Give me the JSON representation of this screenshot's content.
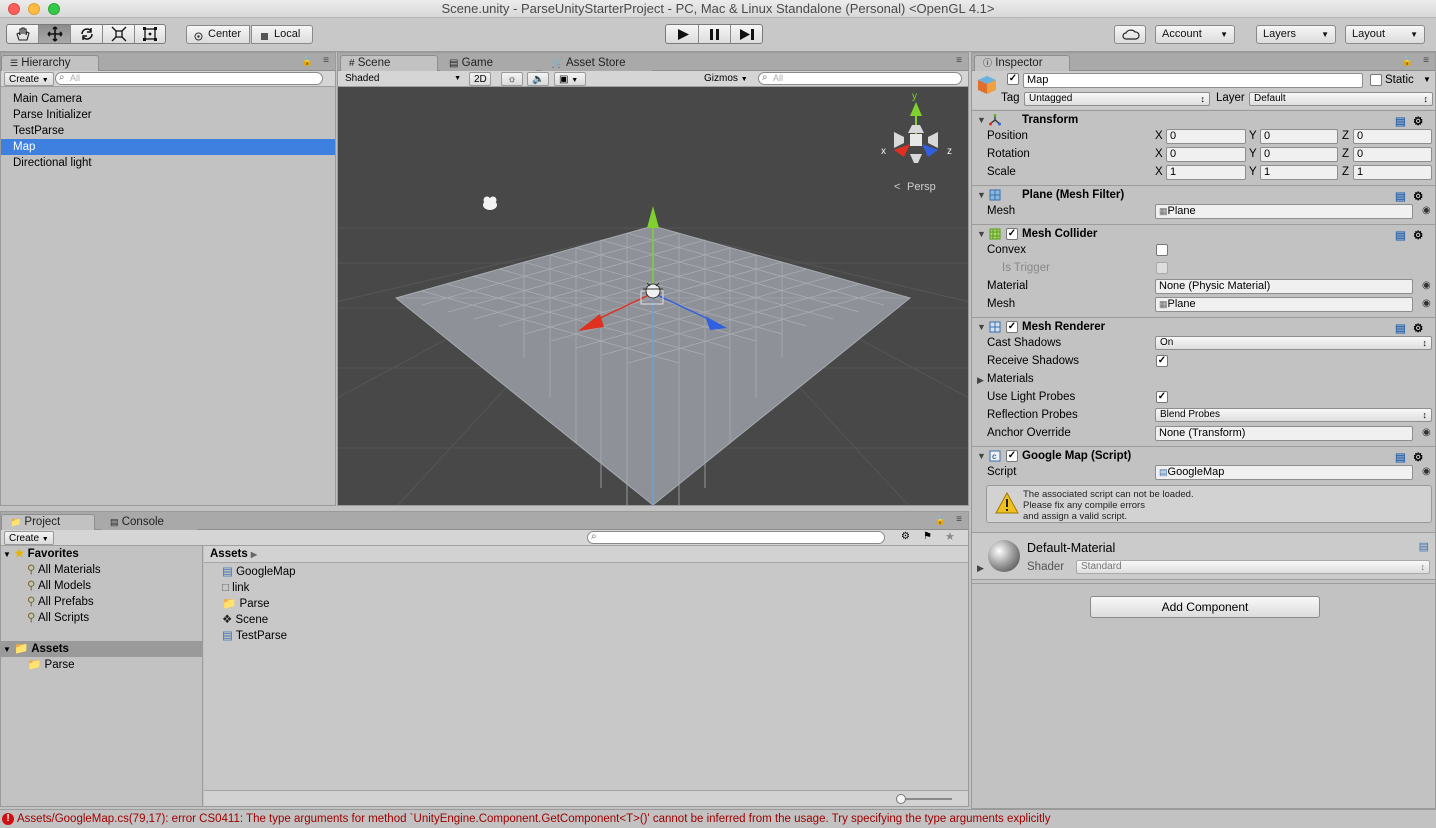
{
  "window": {
    "title": "Scene.unity - ParseUnityStarterProject - PC, Mac & Linux Standalone (Personal) <OpenGL 4.1>"
  },
  "toolbar": {
    "pivot_label": "Center",
    "space_label": "Local",
    "account_label": "Account",
    "layers_label": "Layers",
    "layout_label": "Layout"
  },
  "hierarchy": {
    "tab_label": "Hierarchy",
    "create_label": "Create",
    "search_placeholder": "All",
    "items": [
      "Main Camera",
      "Parse Initializer",
      "TestParse",
      "Map",
      "Directional light"
    ],
    "selected": "Map"
  },
  "scene": {
    "tabs": [
      "Scene",
      "Game",
      "Asset Store"
    ],
    "shading_mode": "Shaded",
    "toggle_2d": "2D",
    "gizmos_label": "Gizmos",
    "search_placeholder": "All",
    "projection_label": "Persp",
    "axis_labels": {
      "x": "x",
      "y": "y",
      "z": "z"
    }
  },
  "project": {
    "tabs": [
      "Project",
      "Console"
    ],
    "create_label": "Create",
    "favorites_label": "Favorites",
    "favorites": [
      "All Materials",
      "All Models",
      "All Prefabs",
      "All Scripts"
    ],
    "assets_label": "Assets",
    "asset_folders": [
      "Parse"
    ],
    "breadcrumb": "Assets",
    "files": [
      "GoogleMap",
      "link",
      "Parse",
      "Scene",
      "TestParse"
    ]
  },
  "inspector": {
    "tab_label": "Inspector",
    "object_name": "Map",
    "static_label": "Static",
    "tag_label": "Tag",
    "tag_value": "Untagged",
    "layer_label": "Layer",
    "layer_value": "Default",
    "transform": {
      "title": "Transform",
      "position_label": "Position",
      "rotation_label": "Rotation",
      "scale_label": "Scale",
      "position": {
        "x": "0",
        "y": "0",
        "z": "0"
      },
      "rotation": {
        "x": "0",
        "y": "0",
        "z": "0"
      },
      "scale": {
        "x": "1",
        "y": "1",
        "z": "1"
      }
    },
    "mesh_filter": {
      "title": "Plane (Mesh Filter)",
      "mesh_label": "Mesh",
      "mesh_value": "Plane"
    },
    "mesh_collider": {
      "title": "Mesh Collider",
      "convex_label": "Convex",
      "is_trigger_label": "Is Trigger",
      "material_label": "Material",
      "material_value": "None (Physic Material)",
      "mesh_label": "Mesh",
      "mesh_value": "Plane"
    },
    "mesh_renderer": {
      "title": "Mesh Renderer",
      "cast_shadows_label": "Cast Shadows",
      "cast_shadows_value": "On",
      "receive_shadows_label": "Receive Shadows",
      "materials_label": "Materials",
      "use_light_probes_label": "Use Light Probes",
      "reflection_probes_label": "Reflection Probes",
      "reflection_probes_value": "Blend Probes",
      "anchor_override_label": "Anchor Override",
      "anchor_override_value": "None (Transform)"
    },
    "google_map": {
      "title": "Google Map (Script)",
      "script_label": "Script",
      "script_value": "GoogleMap",
      "warning_line1": "The associated script can not be loaded.",
      "warning_line2": "Please fix any compile errors",
      "warning_line3": "and assign a valid script."
    },
    "material": {
      "name": "Default-Material",
      "shader_label": "Shader",
      "shader_value": "Standard"
    },
    "add_component_label": "Add Component"
  },
  "status": {
    "error_text": "Assets/GoogleMap.cs(79,17): error CS0411: The type arguments for method `UnityEngine.Component.GetComponent<T>()' cannot be inferred from the usage. Try specifying the type arguments explicitly"
  },
  "colors": {
    "selection": "#3d80df",
    "error": "#a00000",
    "x_axis": "#e03020",
    "y_axis": "#80d030",
    "z_axis": "#3060e0"
  }
}
